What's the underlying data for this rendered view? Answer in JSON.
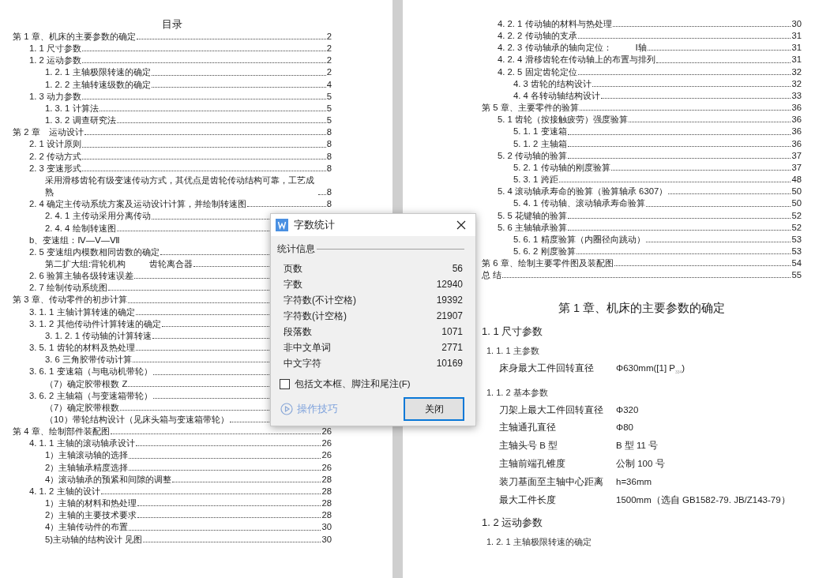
{
  "left_page": {
    "toc_title": "目录",
    "toc": [
      {
        "title": "第 1 章、机床的主要参数的确定",
        "page": "2",
        "children": [
          {
            "title": "1. 1 尺寸参数",
            "page": "2"
          },
          {
            "title": "1. 2 运动参数",
            "page": "2",
            "children": [
              {
                "title": "1. 2. 1 主轴极限转速的确定",
                "page": "2"
              },
              {
                "title": "1. 2. 2 主轴转速级数的确定",
                "page": "4"
              }
            ]
          },
          {
            "title": "1. 3 动力参数",
            "page": "5",
            "children": [
              {
                "title": "1. 3. 1 计算法",
                "page": "5"
              },
              {
                "title": "1. 3. 2 调查研究法",
                "page": "5"
              }
            ]
          }
        ]
      },
      {
        "title": "第 2 章　运动设计",
        "page": "8",
        "children": [
          {
            "title": "2. 1 设计原则",
            "page": "8"
          },
          {
            "title": "2. 2 传动方式",
            "page": "8"
          },
          {
            "title": "2. 3 变速形式",
            "page": "8",
            "children": [
              {
                "title": "采用滑移齿轮有级变速传动方式，其优点是齿轮传动结构可靠，工艺成熟",
                "page": "8"
              }
            ]
          },
          {
            "title": "2. 4 确定主传动系统方案及运动设计计算，并绘制转速图",
            "page": "8",
            "children": [
              {
                "title": "2. 4. 1 主传动采用分离传动"
              },
              {
                "title": "2. 4. 4 绘制转速图"
              }
            ]
          },
          {
            "title": "b、变速组：Ⅳ—Ⅴ—Ⅶ",
            "no_leader": true
          },
          {
            "title": "2. 5 变速组内模数相同齿数的确定",
            "children": [
              {
                "title": "第二扩大组:背轮机构",
                "title_2": "齿轮离合器"
              }
            ]
          },
          {
            "title": "2. 6 验算主轴各级转速误差"
          },
          {
            "title": "2. 7 绘制传动系统图"
          }
        ]
      },
      {
        "title": "第 3 章、传动零件的初步计算",
        "children": [
          {
            "title": "3. 1. 1 主轴计算转速的确定"
          },
          {
            "title": "3. 1. 2 其他传动件计算转速的确定",
            "children": [
              {
                "title": "3. 1. 2. 1 传动轴的计算转速"
              }
            ]
          },
          {
            "title": "3. 5. 1 齿轮的材料及热处理",
            "children": [
              {
                "title": "3. 6 三角胶带传动计算"
              }
            ]
          },
          {
            "title": "3. 6. 1 变速箱（与电动机带轮）",
            "children": [
              {
                "title": "（7）确定胶带根数 Z"
              }
            ]
          },
          {
            "title": "3. 6. 2 主轴箱（与变速箱带轮）",
            "children": [
              {
                "title": "（7）确定胶带根数"
              },
              {
                "title": "（10）带轮结构设计（见床头箱与变速箱带轮）"
              }
            ]
          }
        ]
      },
      {
        "title": "第 4 章、绘制部件装配图",
        "page": "26",
        "children": [
          {
            "title": "4. 1. 1 主轴的滚动轴承设计",
            "page": "26",
            "children": [
              {
                "title": "1）主轴滚动轴的选择",
                "page": "26"
              },
              {
                "title": "2）主轴轴承精度选择",
                "page": "26"
              },
              {
                "title": "4）滚动轴承的预紧和间隙的调整",
                "page": "28"
              }
            ]
          },
          {
            "title": "4. 1. 2 主轴的设计",
            "page": "28",
            "children": [
              {
                "title": "1）主轴的材料和热处理",
                "page": "28"
              },
              {
                "title": "2）主轴的主要技术要求",
                "page": "28"
              },
              {
                "title": "4）主轴传动件的布置",
                "page": "30"
              },
              {
                "title": "5)主动轴的结构设计 见图",
                "page": "30"
              }
            ]
          }
        ]
      }
    ]
  },
  "right_page": {
    "toc": [
      {
        "children": [
          {
            "title": "4. 2. 1  传动轴的材料与热处理",
            "page": "30"
          },
          {
            "title": "4. 2. 2  传动轴的支承",
            "page": "31"
          },
          {
            "title": "4. 2. 3  传动轴承的轴向定位：",
            "title_2": "Ⅰ轴",
            "page": "31"
          },
          {
            "title": "4. 2. 4  滑移齿轮在传动轴上的布置与排列",
            "page": "31"
          },
          {
            "title": "4. 2. 5  固定齿轮定位",
            "page": "32",
            "children": [
              {
                "title": "4. 3  齿轮的结构设计",
                "page": "32"
              },
              {
                "title": "4. 4  各转动轴结构设计",
                "page": "33"
              }
            ]
          }
        ]
      },
      {
        "title": "第 5 章、主要零件的验算",
        "page": "36",
        "children": [
          {
            "title": "5. 1  齿轮（按接触疲劳）强度验算",
            "page": "36",
            "children": [
              {
                "title": "5. 1. 1 变速箱",
                "page": "36"
              },
              {
                "title": "5. 1. 2 主轴箱",
                "page": "36"
              }
            ]
          },
          {
            "title": "5. 2  传动轴的验算",
            "page": "37",
            "children": [
              {
                "title": "5. 2. 1 传动轴的刚度验算",
                "page": "37"
              },
              {
                "title": "5. 3. 1  跨距",
                "page": "48"
              }
            ]
          },
          {
            "title": "5. 4  滚动轴承寿命的验算（验算轴承 6307）",
            "page": "50",
            "children": [
              {
                "title": "5. 4. 1  传动轴、滚动轴承寿命验算",
                "page": "50"
              }
            ]
          },
          {
            "title": "5. 5 花键轴的验算",
            "page": "52"
          },
          {
            "title": "5. 6 主轴轴承验算",
            "page": "52",
            "children": [
              {
                "title": "5. 6. 1 精度验算（内圈径向跳动）",
                "page": "53"
              },
              {
                "title": "5. 6. 2 刚度验算",
                "page": "53"
              }
            ]
          }
        ]
      },
      {
        "title": "第 6 章、绘制主要零件图及装配图",
        "page": "54"
      },
      {
        "title": "总  结",
        "page": "55"
      }
    ],
    "body": [
      {
        "kind": "chapter",
        "text": "第 1 章、机床的主要参数的确定"
      },
      {
        "kind": "section",
        "text": "1. 1 尺寸参数"
      },
      {
        "kind": "subsection",
        "text": "1. 1. 1 主参数"
      },
      {
        "kind": "param",
        "name": "床身最大工件回转直径",
        "value": "Φ630mm([1] P$_{334}$)"
      },
      {
        "kind": "subsection",
        "text": "1. 1. 2 基本参数"
      },
      {
        "kind": "param",
        "name": "刀架上最大工件回转直径",
        "value": "Φ320"
      },
      {
        "kind": "param",
        "name": "主轴通孔直径",
        "value": "Φ80"
      },
      {
        "kind": "param",
        "name": "主轴头号 B 型",
        "value": "B 型 11 号"
      },
      {
        "kind": "param",
        "name": "主轴前端孔锥度",
        "value": "公制 100 号"
      },
      {
        "kind": "param",
        "name": "装刀基面至主轴中心距离",
        "value": "h=36mm"
      },
      {
        "kind": "param",
        "name": "最大工件长度",
        "value": "1500mm（选自 GB1582-79. JB/Z143-79）"
      },
      {
        "kind": "section",
        "text": "1. 2 运动参数"
      },
      {
        "kind": "subsection",
        "text": "1. 2. 1 主轴极限转速的确定"
      }
    ]
  },
  "dialog": {
    "title": "字数统计",
    "group": "统计信息",
    "stats": [
      {
        "label": "页数",
        "value": "56"
      },
      {
        "label": "字数",
        "value": "12940"
      },
      {
        "label": "字符数(不计空格)",
        "value": "19392"
      },
      {
        "label": "字符数(计空格)",
        "value": "21907"
      },
      {
        "label": "段落数",
        "value": "1071"
      },
      {
        "label": "非中文单词",
        "value": "2771"
      },
      {
        "label": "中文字符",
        "value": "10169"
      }
    ],
    "checkbox": {
      "label": "包括文本框、脚注和尾注(F)",
      "checked": false
    },
    "tips_link": "操作技巧",
    "close_button": {
      "label": "关闭",
      "focused": true
    }
  }
}
